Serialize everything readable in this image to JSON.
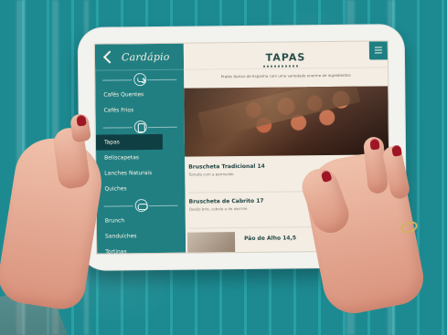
{
  "sidebar": {
    "title": "Cardápio",
    "items": [
      "Cafés Quentes",
      "Cafés Frios",
      "Tapas",
      "Beliscapetas",
      "Lanches Naturais",
      "Quiches",
      "Brunch",
      "Sanduíches",
      "Tortinas"
    ]
  },
  "main": {
    "title": "TAPAS",
    "subtitle": "Pratos típicos de Espanha com uma variedade enorme de ingredientes",
    "items": [
      {
        "name": "Bruscheta Tradicional 14",
        "description": "Tomate com a parmesão"
      },
      {
        "name": "Bruscheta de Cabrito 17",
        "description": "Queijo brie, cebola e de alecrim"
      },
      {
        "name": "Pão de Alho 14,5"
      }
    ]
  },
  "colors": {
    "teal": "#217f82",
    "dark_teal": "#103f43",
    "paper": "#f4ede3",
    "nail": "#9e1625"
  },
  "icons": {
    "back": "chevron-left-icon",
    "coffee": "coffee-icon",
    "drink": "drink-icon",
    "snack": "snack-icon",
    "menu": "hamburger-icon"
  }
}
